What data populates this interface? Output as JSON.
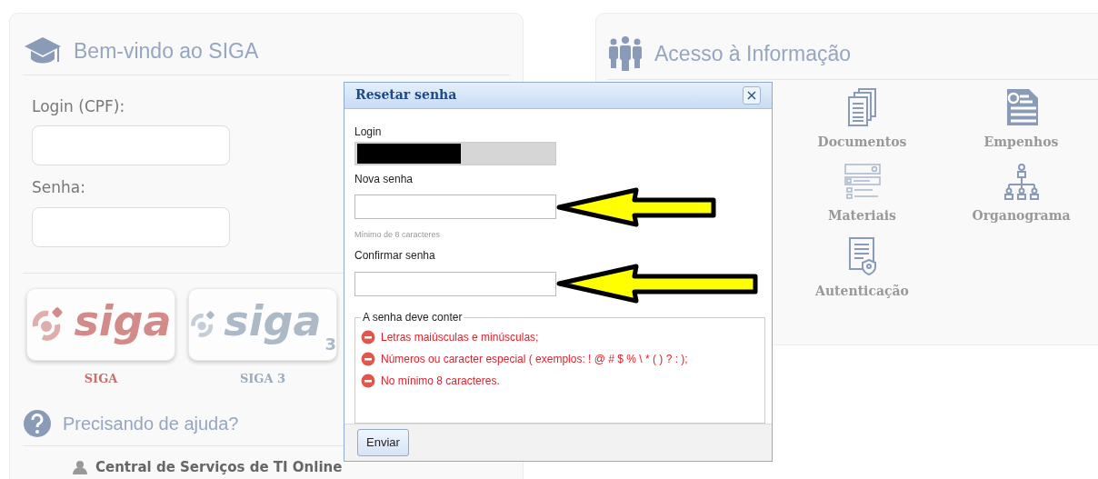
{
  "left_panel": {
    "title": "Bem-vindo ao SIGA",
    "fields": [
      {
        "label": "Login (CPF):"
      },
      {
        "label": "Senha:"
      }
    ],
    "systems": [
      {
        "kind": "classic",
        "logo_text": "siga",
        "label": "SIGA"
      },
      {
        "kind": "v3",
        "logo_text": "siga",
        "logo_sub": "3",
        "label": "SIGA 3"
      }
    ],
    "help_title": "Precisando de ajuda?",
    "help_link": "Central de Serviços de TI Online"
  },
  "right_panel": {
    "title": "Acesso à Informação",
    "items": [
      {
        "kind": "documents",
        "label": "Documentos"
      },
      {
        "kind": "payment",
        "label": "Empenhos"
      },
      {
        "kind": "catalog",
        "label": "Materiais"
      },
      {
        "kind": "orgchart",
        "label": "Organograma"
      },
      {
        "kind": "certificate",
        "label": "Autenticação"
      }
    ]
  },
  "dialog": {
    "title": "Resetar senha",
    "close": "×",
    "login_label": "Login",
    "new_label": "Nova senha",
    "new_hint": "Mínimo de 8 caracteres",
    "confirm_label": "Confirmar senha",
    "rules_title": "A senha deve conter",
    "rules": [
      {
        "text": "Letras maiúsculas e minúsculas;",
        "met": false
      },
      {
        "text": "Números ou caracter especial ( exemplos: ! @ # $ % \\ * ( ) ? : );",
        "met": false
      },
      {
        "text": "No mínimo 8 caracteres.",
        "met": false
      }
    ],
    "submit": "Enviar"
  }
}
